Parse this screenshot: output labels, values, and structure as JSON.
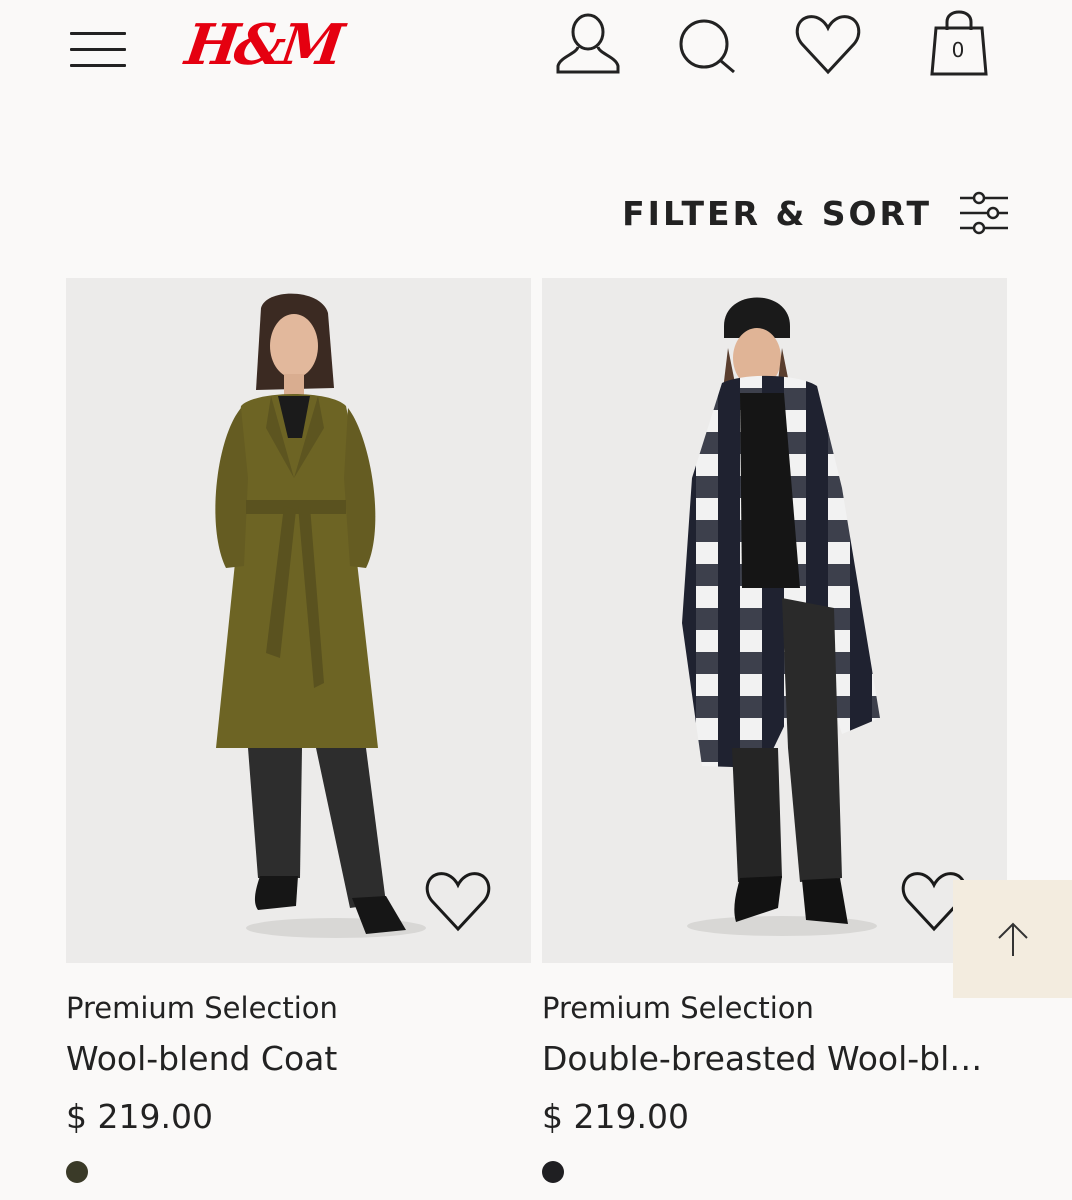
{
  "header": {
    "logo": "H&M",
    "cart_count": "0",
    "icons": [
      "menu-icon",
      "account-icon",
      "search-icon",
      "favorites-icon",
      "shopping-bag-icon"
    ]
  },
  "toolbar": {
    "filter_sort_label": "FILTER & SORT",
    "icon": "sliders-icon"
  },
  "products": [
    {
      "brand": "Premium Selection",
      "name": "Wool-blend Coat",
      "price": "$ 219.00",
      "swatch_color": "#3a3a28"
    },
    {
      "brand": "Premium Selection",
      "name": "Double-breasted Wool-ble…",
      "price": "$ 219.00",
      "swatch_color": "#1f1f22"
    }
  ],
  "colors": {
    "brand_red": "#e50010",
    "background": "#faf9f8",
    "image_bg": "#ecebea",
    "back_to_top_bg": "#f3ecdf"
  }
}
